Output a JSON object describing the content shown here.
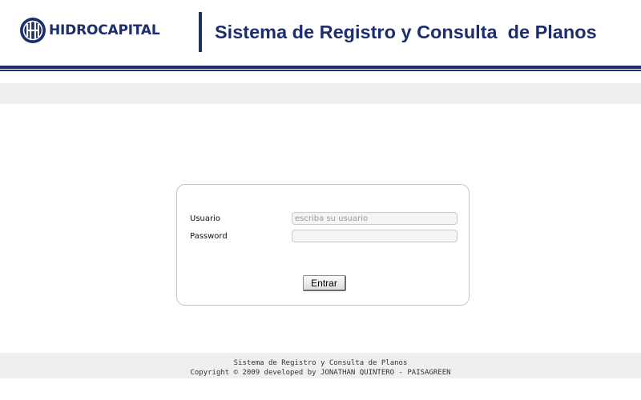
{
  "header": {
    "logo_text": "HIDROCAPITAL",
    "logo_icon": "hidrocapital-logo-icon",
    "title": "Sistema de Registro y Consulta  de Planos"
  },
  "login": {
    "username_label": "Usuario",
    "username_placeholder": "escriba su usuario",
    "username_value": "",
    "password_label": "Password",
    "password_value": "",
    "submit_label": "Entrar"
  },
  "footer": {
    "line1": "Sistema de Registro y Consulta de Planos",
    "line2": "Copyright © 2009 developed by JONATHAN QUINTERO - PAISAGREEN"
  },
  "colors": {
    "brand_navy": "#1c2e6e",
    "band_gray": "#efefef",
    "box_border": "#c2c2c2"
  }
}
